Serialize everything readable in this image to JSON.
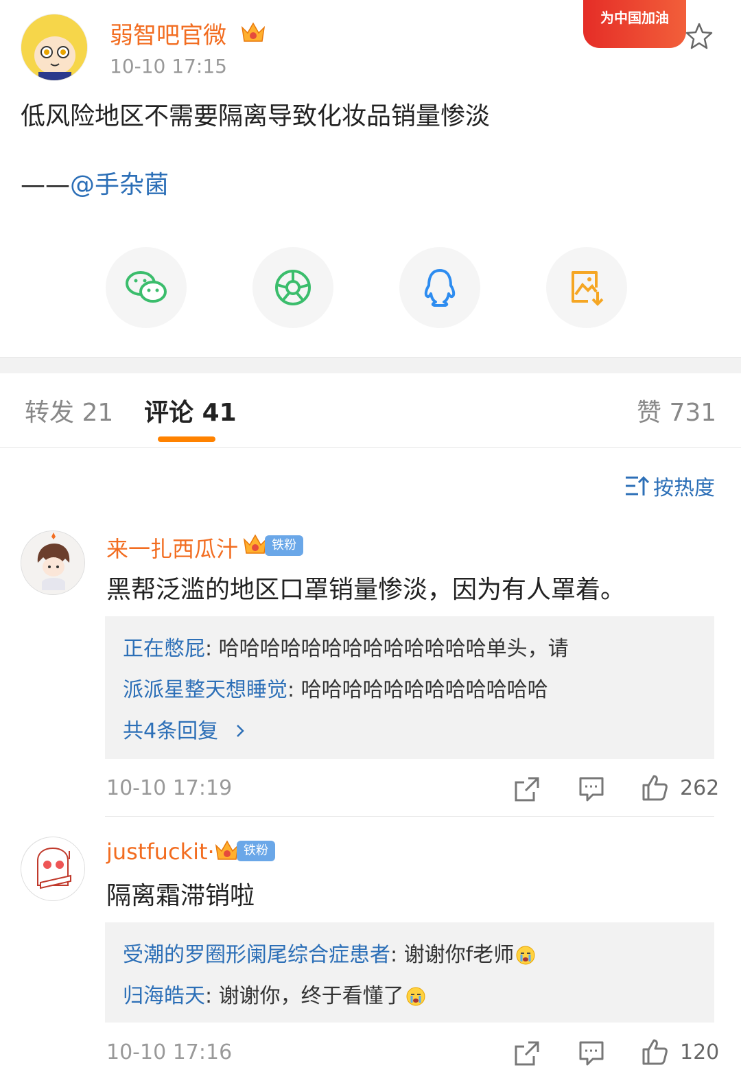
{
  "post": {
    "author": "弱智吧官微",
    "time": "10-10 17:15",
    "promo": "为中国加油",
    "body": "低风险地区不需要隔离导致化妆品销量惨淡",
    "signature_prefix": "——",
    "signature_mention": "@手杂菌"
  },
  "share": {
    "items": [
      "wechat-icon",
      "moments-icon",
      "qq-icon",
      "save-image-icon"
    ]
  },
  "tabs": {
    "repost_label": "转发",
    "repost_count": "21",
    "comment_label": "评论",
    "comment_count": "41",
    "like_label": "赞",
    "like_count": "731"
  },
  "sort": {
    "label": "按热度"
  },
  "comments": [
    {
      "user": "来一扎西瓜汁",
      "badge": "铁粉",
      "text": "黑帮泛滥的地区口罩销量惨淡，因为有人罩着。",
      "replies": [
        {
          "name": "正在憋屁",
          "text": ": 哈哈哈哈哈哈哈哈哈哈哈哈哈单头，请"
        },
        {
          "name": "派派星整天想睡觉",
          "text": ": 哈哈哈哈哈哈哈哈哈哈哈哈"
        }
      ],
      "more": "共4条回复",
      "time": "10-10 17:19",
      "likes": "262"
    },
    {
      "user": "justfuckit·",
      "badge": "铁粉",
      "text": "隔离霜滞销啦",
      "replies": [
        {
          "name": "受潮的罗圈形阑尾综合症患者",
          "text": ": 谢谢你f老师"
        },
        {
          "name": "归海皓天",
          "text": ": 谢谢你，终于看懂了"
        }
      ],
      "time": "10-10 17:16",
      "likes": "120"
    }
  ],
  "colors": {
    "accent_orange": "#ff8200",
    "name_orange": "#f26d21",
    "link_blue": "#2c6fb7",
    "badge_blue": "#6aa7e8"
  }
}
